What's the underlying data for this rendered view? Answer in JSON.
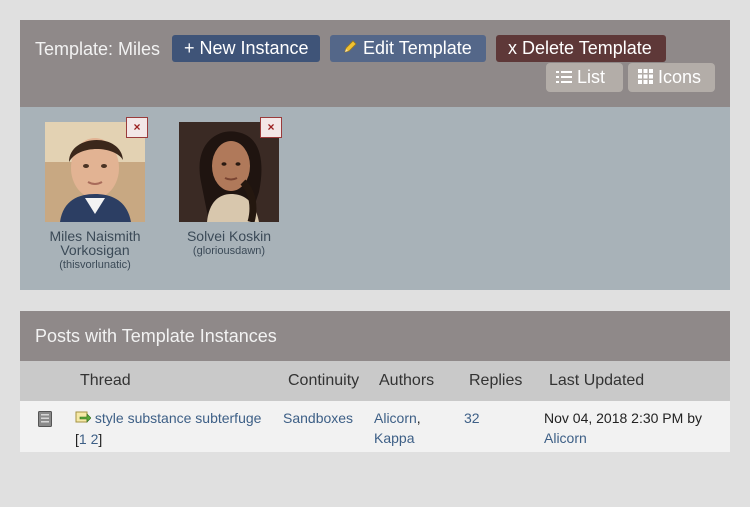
{
  "template": {
    "title": "Template: Miles",
    "new_instance_label": "+ New Instance",
    "edit_template_label": "Edit Template",
    "delete_template_label": "x Delete Template",
    "view_list_label": "List",
    "view_icons_label": "Icons"
  },
  "characters": [
    {
      "name": "Miles Naismith Vorkosigan",
      "user": "(thisvorlunatic)",
      "remove": "×"
    },
    {
      "name": "Solvei Koskin",
      "user": "(gloriousdawn)",
      "remove": "×"
    }
  ],
  "posts": {
    "heading": "Posts with Template Instances",
    "columns": [
      "Thread",
      "Continuity",
      "Authors",
      "Replies",
      "Last Updated"
    ],
    "rows": [
      {
        "thread": "style substance subterfuge",
        "page_open": "[",
        "page1": "1",
        "page2": "2",
        "page_close": "]",
        "continuity": "Sandboxes",
        "author1": "Alicorn",
        "author_sep": ",",
        "author2": "Kappa",
        "replies": "32",
        "updated": "Nov 04, 2018 2:30 PM by",
        "updated_by": "Alicorn"
      }
    ]
  },
  "colors": {
    "header_bg": "#8f8989",
    "panel_bg": "#a8b2b8",
    "link": "#3d5f86",
    "new_button": "#3f5478",
    "edit_button": "#546789",
    "delete_button": "#5e3838"
  },
  "icons": [
    "pencil-icon",
    "list-icon",
    "grid-icon",
    "remove-icon",
    "thread-status-icon",
    "new-post-icon"
  ]
}
